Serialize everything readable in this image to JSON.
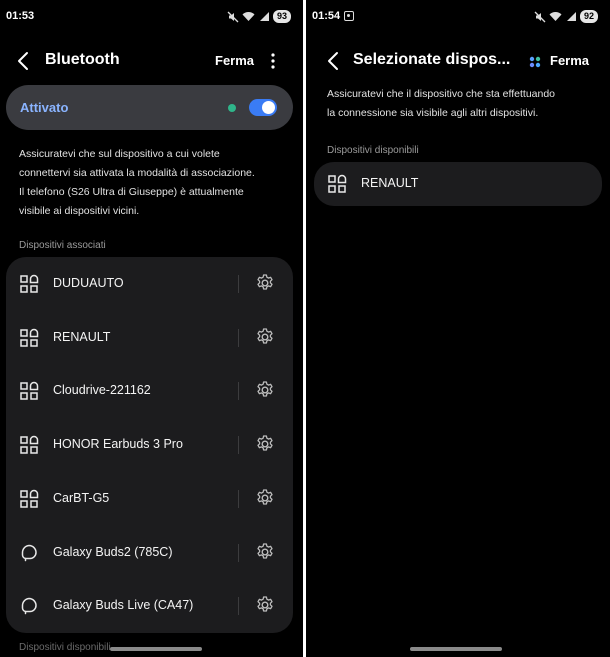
{
  "left": {
    "status": {
      "time": "01:53",
      "battery": "93"
    },
    "appbar": {
      "title": "Bluetooth",
      "stop": "Ferma"
    },
    "toggle": {
      "label": "Attivato",
      "on": true
    },
    "description": [
      "Assicuratevi che sul dispositivo a cui volete",
      "connettervi sia attivata la modalità di associazione.",
      "Il telefono (S26 Ultra di Giuseppe) è attualmente",
      "visibile ai dispositivi vicini."
    ],
    "paired_section": "Dispositivi associati",
    "devices": [
      {
        "name": "DUDUAUTO",
        "icon": "device-grid-icon"
      },
      {
        "name": "RENAULT",
        "icon": "device-grid-icon"
      },
      {
        "name": "Cloudrive-221162",
        "icon": "device-grid-icon"
      },
      {
        "name": "HONOR Earbuds 3 Pro",
        "icon": "device-grid-icon"
      },
      {
        "name": "CarBT-G5",
        "icon": "device-grid-icon"
      },
      {
        "name": "Galaxy Buds2 (785C)",
        "icon": "earbud-icon"
      },
      {
        "name": "Galaxy Buds Live (CA47)",
        "icon": "earbud-icon"
      }
    ],
    "available_section_partial": "Dispositivi disponibili"
  },
  "right": {
    "status": {
      "time": "01:54",
      "battery": "92"
    },
    "appbar": {
      "title": "Selezionate dispos...",
      "stop": "Ferma"
    },
    "description": [
      "Assicuratevi che il dispositivo che sta effettuando",
      "la connessione sia visibile agli altri dispositivi."
    ],
    "available_section": "Dispositivi disponibili",
    "devices": [
      {
        "name": "RENAULT",
        "icon": "device-grid-icon"
      }
    ]
  },
  "colors": {
    "accent": "#3a7cf5",
    "label_blue": "#8ab4ff",
    "status_dot": "#2fb58a",
    "card": "#1c1c1e"
  }
}
